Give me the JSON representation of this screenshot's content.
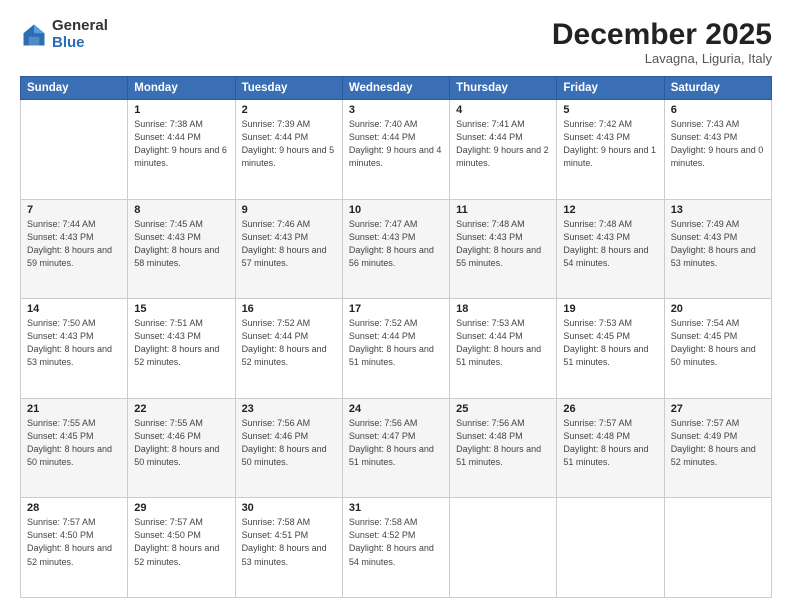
{
  "logo": {
    "general": "General",
    "blue": "Blue"
  },
  "header": {
    "title": "December 2025",
    "location": "Lavagna, Liguria, Italy"
  },
  "days_of_week": [
    "Sunday",
    "Monday",
    "Tuesday",
    "Wednesday",
    "Thursday",
    "Friday",
    "Saturday"
  ],
  "weeks": [
    [
      {
        "num": "",
        "sunrise": "",
        "sunset": "",
        "daylight": ""
      },
      {
        "num": "1",
        "sunrise": "Sunrise: 7:38 AM",
        "sunset": "Sunset: 4:44 PM",
        "daylight": "Daylight: 9 hours and 6 minutes."
      },
      {
        "num": "2",
        "sunrise": "Sunrise: 7:39 AM",
        "sunset": "Sunset: 4:44 PM",
        "daylight": "Daylight: 9 hours and 5 minutes."
      },
      {
        "num": "3",
        "sunrise": "Sunrise: 7:40 AM",
        "sunset": "Sunset: 4:44 PM",
        "daylight": "Daylight: 9 hours and 4 minutes."
      },
      {
        "num": "4",
        "sunrise": "Sunrise: 7:41 AM",
        "sunset": "Sunset: 4:44 PM",
        "daylight": "Daylight: 9 hours and 2 minutes."
      },
      {
        "num": "5",
        "sunrise": "Sunrise: 7:42 AM",
        "sunset": "Sunset: 4:43 PM",
        "daylight": "Daylight: 9 hours and 1 minute."
      },
      {
        "num": "6",
        "sunrise": "Sunrise: 7:43 AM",
        "sunset": "Sunset: 4:43 PM",
        "daylight": "Daylight: 9 hours and 0 minutes."
      }
    ],
    [
      {
        "num": "7",
        "sunrise": "Sunrise: 7:44 AM",
        "sunset": "Sunset: 4:43 PM",
        "daylight": "Daylight: 8 hours and 59 minutes."
      },
      {
        "num": "8",
        "sunrise": "Sunrise: 7:45 AM",
        "sunset": "Sunset: 4:43 PM",
        "daylight": "Daylight: 8 hours and 58 minutes."
      },
      {
        "num": "9",
        "sunrise": "Sunrise: 7:46 AM",
        "sunset": "Sunset: 4:43 PM",
        "daylight": "Daylight: 8 hours and 57 minutes."
      },
      {
        "num": "10",
        "sunrise": "Sunrise: 7:47 AM",
        "sunset": "Sunset: 4:43 PM",
        "daylight": "Daylight: 8 hours and 56 minutes."
      },
      {
        "num": "11",
        "sunrise": "Sunrise: 7:48 AM",
        "sunset": "Sunset: 4:43 PM",
        "daylight": "Daylight: 8 hours and 55 minutes."
      },
      {
        "num": "12",
        "sunrise": "Sunrise: 7:48 AM",
        "sunset": "Sunset: 4:43 PM",
        "daylight": "Daylight: 8 hours and 54 minutes."
      },
      {
        "num": "13",
        "sunrise": "Sunrise: 7:49 AM",
        "sunset": "Sunset: 4:43 PM",
        "daylight": "Daylight: 8 hours and 53 minutes."
      }
    ],
    [
      {
        "num": "14",
        "sunrise": "Sunrise: 7:50 AM",
        "sunset": "Sunset: 4:43 PM",
        "daylight": "Daylight: 8 hours and 53 minutes."
      },
      {
        "num": "15",
        "sunrise": "Sunrise: 7:51 AM",
        "sunset": "Sunset: 4:43 PM",
        "daylight": "Daylight: 8 hours and 52 minutes."
      },
      {
        "num": "16",
        "sunrise": "Sunrise: 7:52 AM",
        "sunset": "Sunset: 4:44 PM",
        "daylight": "Daylight: 8 hours and 52 minutes."
      },
      {
        "num": "17",
        "sunrise": "Sunrise: 7:52 AM",
        "sunset": "Sunset: 4:44 PM",
        "daylight": "Daylight: 8 hours and 51 minutes."
      },
      {
        "num": "18",
        "sunrise": "Sunrise: 7:53 AM",
        "sunset": "Sunset: 4:44 PM",
        "daylight": "Daylight: 8 hours and 51 minutes."
      },
      {
        "num": "19",
        "sunrise": "Sunrise: 7:53 AM",
        "sunset": "Sunset: 4:45 PM",
        "daylight": "Daylight: 8 hours and 51 minutes."
      },
      {
        "num": "20",
        "sunrise": "Sunrise: 7:54 AM",
        "sunset": "Sunset: 4:45 PM",
        "daylight": "Daylight: 8 hours and 50 minutes."
      }
    ],
    [
      {
        "num": "21",
        "sunrise": "Sunrise: 7:55 AM",
        "sunset": "Sunset: 4:45 PM",
        "daylight": "Daylight: 8 hours and 50 minutes."
      },
      {
        "num": "22",
        "sunrise": "Sunrise: 7:55 AM",
        "sunset": "Sunset: 4:46 PM",
        "daylight": "Daylight: 8 hours and 50 minutes."
      },
      {
        "num": "23",
        "sunrise": "Sunrise: 7:56 AM",
        "sunset": "Sunset: 4:46 PM",
        "daylight": "Daylight: 8 hours and 50 minutes."
      },
      {
        "num": "24",
        "sunrise": "Sunrise: 7:56 AM",
        "sunset": "Sunset: 4:47 PM",
        "daylight": "Daylight: 8 hours and 51 minutes."
      },
      {
        "num": "25",
        "sunrise": "Sunrise: 7:56 AM",
        "sunset": "Sunset: 4:48 PM",
        "daylight": "Daylight: 8 hours and 51 minutes."
      },
      {
        "num": "26",
        "sunrise": "Sunrise: 7:57 AM",
        "sunset": "Sunset: 4:48 PM",
        "daylight": "Daylight: 8 hours and 51 minutes."
      },
      {
        "num": "27",
        "sunrise": "Sunrise: 7:57 AM",
        "sunset": "Sunset: 4:49 PM",
        "daylight": "Daylight: 8 hours and 52 minutes."
      }
    ],
    [
      {
        "num": "28",
        "sunrise": "Sunrise: 7:57 AM",
        "sunset": "Sunset: 4:50 PM",
        "daylight": "Daylight: 8 hours and 52 minutes."
      },
      {
        "num": "29",
        "sunrise": "Sunrise: 7:57 AM",
        "sunset": "Sunset: 4:50 PM",
        "daylight": "Daylight: 8 hours and 52 minutes."
      },
      {
        "num": "30",
        "sunrise": "Sunrise: 7:58 AM",
        "sunset": "Sunset: 4:51 PM",
        "daylight": "Daylight: 8 hours and 53 minutes."
      },
      {
        "num": "31",
        "sunrise": "Sunrise: 7:58 AM",
        "sunset": "Sunset: 4:52 PM",
        "daylight": "Daylight: 8 hours and 54 minutes."
      },
      {
        "num": "",
        "sunrise": "",
        "sunset": "",
        "daylight": ""
      },
      {
        "num": "",
        "sunrise": "",
        "sunset": "",
        "daylight": ""
      },
      {
        "num": "",
        "sunrise": "",
        "sunset": "",
        "daylight": ""
      }
    ]
  ]
}
